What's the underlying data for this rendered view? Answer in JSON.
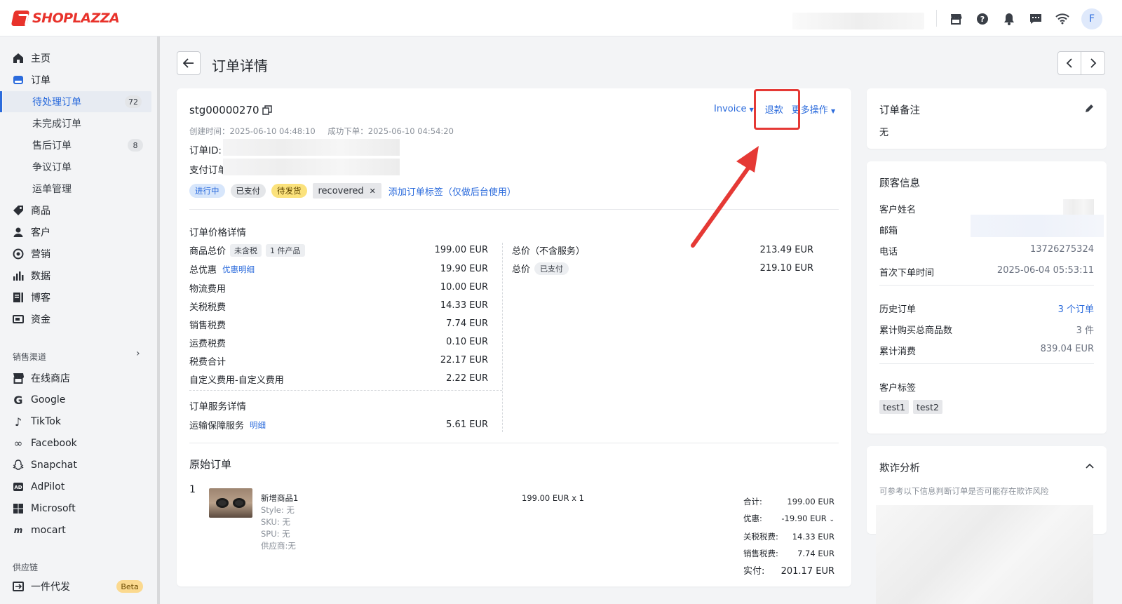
{
  "brand": {
    "name": "SHOPLAZZA",
    "color": "#e8322b"
  },
  "user": {
    "avatar_initial": "F"
  },
  "top_icons": [
    "store-icon",
    "help-icon",
    "bell-icon",
    "message-icon",
    "wifi-icon"
  ],
  "sidebar": {
    "items": [
      {
        "label": "主页",
        "icon": "home-icon"
      },
      {
        "label": "订单",
        "icon": "order-icon"
      },
      {
        "label": "待处理订单",
        "badge": "72",
        "active": true
      },
      {
        "label": "未完成订单"
      },
      {
        "label": "售后订单",
        "badge": "8"
      },
      {
        "label": "争议订单"
      },
      {
        "label": "运单管理"
      },
      {
        "label": "商品",
        "icon": "tag-icon"
      },
      {
        "label": "客户",
        "icon": "person-icon"
      },
      {
        "label": "营销",
        "icon": "marketing-icon"
      },
      {
        "label": "数据",
        "icon": "chart-icon"
      },
      {
        "label": "博客",
        "icon": "blog-icon"
      },
      {
        "label": "资金",
        "icon": "wallet-icon"
      }
    ],
    "channels_title": "销售渠道",
    "channels": [
      {
        "label": "在线商店",
        "icon": "store-icon"
      },
      {
        "label": "Google",
        "icon": "google-icon"
      },
      {
        "label": "TikTok",
        "icon": "tiktok-icon"
      },
      {
        "label": "Facebook",
        "icon": "meta-icon"
      },
      {
        "label": "Snapchat",
        "icon": "snapchat-icon"
      },
      {
        "label": "AdPilot",
        "icon": "ad-icon"
      },
      {
        "label": "Microsoft",
        "icon": "windows-icon"
      },
      {
        "label": "mocart",
        "icon": "mocart-icon"
      }
    ],
    "supply_title": "供应链",
    "supply": [
      {
        "label": "一件代发",
        "badge": "Beta",
        "icon": "dropship-icon"
      }
    ]
  },
  "header": {
    "title": "订单详情"
  },
  "order": {
    "number": "stg00000270",
    "created": "创建时间：2025-06-10 04:48:10",
    "success": "成功下单：2025-06-10 04:54:20",
    "order_id_label": "订单ID:",
    "pay_label": "支付订单",
    "actions": {
      "invoice": "Invoice",
      "refund": "退款",
      "more": "更多操作"
    },
    "tags": [
      "进行中",
      "已支付",
      "待发货"
    ],
    "custom_tag": "recovered",
    "add_tag": "添加订单标签（仅做后台使用）",
    "price_title": "订单价格详情",
    "price_rows": [
      {
        "label": "商品总价",
        "tag1": "未含税",
        "tag2": "1 件产品",
        "value": "199.00 EUR"
      },
      {
        "label": "总优惠",
        "link": "优惠明细",
        "value": "19.90 EUR"
      },
      {
        "label": "物流费用",
        "value": "10.00 EUR"
      },
      {
        "label": "关税税费",
        "value": "14.33 EUR"
      },
      {
        "label": "销售税费",
        "value": "7.74 EUR"
      },
      {
        "label": "运费税费",
        "value": "0.10 EUR"
      },
      {
        "label": "税费合计",
        "value": "22.17 EUR"
      },
      {
        "label": "自定义费用-自定义费用",
        "value": "2.22 EUR"
      }
    ],
    "totals": [
      {
        "label": "总价（不含服务）",
        "value": "213.49 EUR"
      },
      {
        "label": "总价",
        "tag": "已支付",
        "value": "219.10 EUR"
      }
    ],
    "service_title": "订单服务详情",
    "service_row": {
      "label": "运输保障服务",
      "link": "明细",
      "value": "5.61 EUR"
    },
    "original_title": "原始订单",
    "line_item": {
      "index": "1",
      "name": "新增商品1",
      "style": "Style: 无",
      "sku": "SKU: 无",
      "spu": "SPU: 无",
      "vendor": "供应商:无",
      "qty_price": "199.00 EUR x 1",
      "summary": [
        {
          "label": "合计:",
          "value": "199.00 EUR"
        },
        {
          "label": "优惠:",
          "value": "-19.90 EUR"
        },
        {
          "label": "关税税费:",
          "value": "14.33 EUR"
        },
        {
          "label": "销售税费:",
          "value": "7.74 EUR"
        }
      ],
      "paid_label": "实付:",
      "paid_value": "201.17 EUR"
    }
  },
  "notes": {
    "title": "订单备注",
    "content": "无"
  },
  "customer": {
    "title": "顾客信息",
    "name_label": "客户姓名",
    "email_label": "邮箱",
    "phone_label": "电话",
    "phone": "13726275324",
    "first_order_label": "首次下单时间",
    "first_order": "2025-06-04 05:53:11",
    "history_label": "历史订单",
    "history": "3 个订单",
    "items_label": "累计购买总商品数",
    "items": "3 件",
    "spent_label": "累计消费",
    "spent": "839.04 EUR",
    "tags_label": "客户标签",
    "tags": [
      "test1",
      "test2"
    ]
  },
  "fraud": {
    "title": "欺诈分析",
    "desc": "可参考以下信息判断订单是否可能存在欺诈风险"
  },
  "colors": {
    "accent": "#2b6bdc",
    "annotation": "#e53935"
  }
}
